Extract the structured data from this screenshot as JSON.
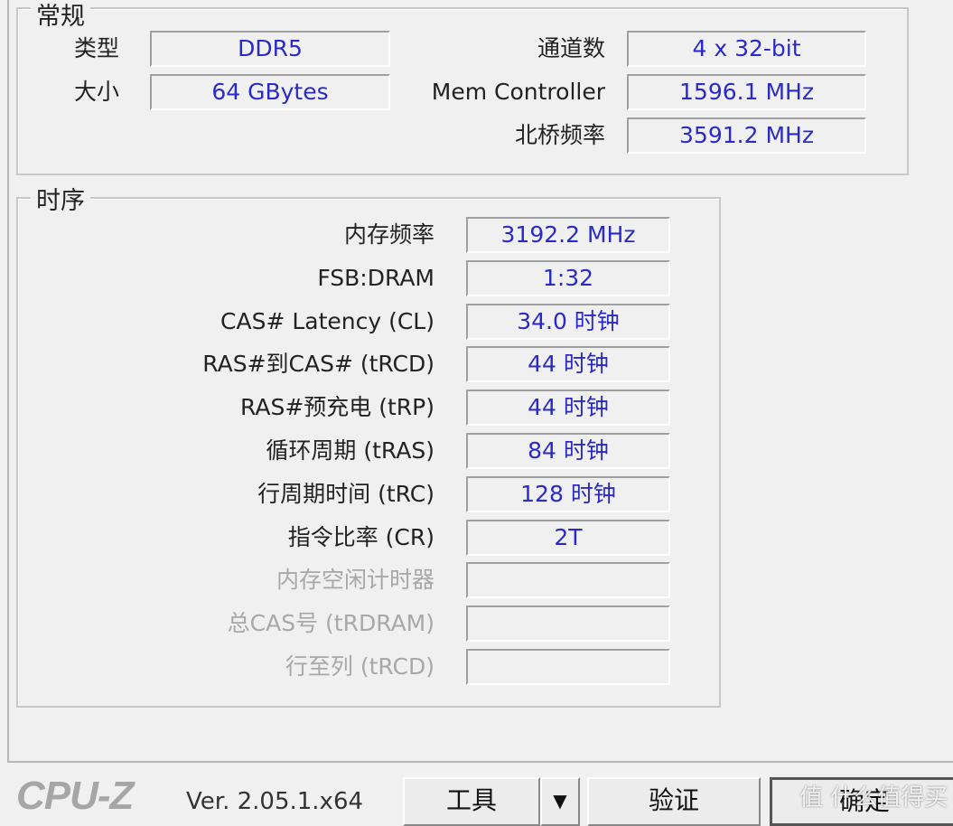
{
  "general": {
    "title": "常规",
    "type_label": "类型",
    "type_value": "DDR5",
    "size_label": "大小",
    "size_value": "64 GBytes",
    "channels_label": "通道数",
    "channels_value": "4 x 32-bit",
    "memctrl_label": "Mem Controller",
    "memctrl_value": "1596.1 MHz",
    "nb_label": "北桥频率",
    "nb_value": "3591.2 MHz"
  },
  "timings": {
    "title": "时序",
    "rows": [
      {
        "label": "内存频率",
        "value": "3192.2 MHz",
        "disabled": false
      },
      {
        "label": "FSB:DRAM",
        "value": "1:32",
        "disabled": false
      },
      {
        "label": "CAS# Latency (CL)",
        "value": "34.0 时钟",
        "disabled": false
      },
      {
        "label": "RAS#到CAS# (tRCD)",
        "value": "44 时钟",
        "disabled": false
      },
      {
        "label": "RAS#预充电 (tRP)",
        "value": "44 时钟",
        "disabled": false
      },
      {
        "label": "循环周期 (tRAS)",
        "value": "84 时钟",
        "disabled": false
      },
      {
        "label": "行周期时间 (tRC)",
        "value": "128 时钟",
        "disabled": false
      },
      {
        "label": "指令比率 (CR)",
        "value": "2T",
        "disabled": false
      },
      {
        "label": "内存空闲计时器",
        "value": "",
        "disabled": true
      },
      {
        "label": "总CAS号 (tRDRAM)",
        "value": "",
        "disabled": true
      },
      {
        "label": "行至列 (tRCD)",
        "value": "",
        "disabled": true
      }
    ]
  },
  "footer": {
    "logo": "CPU-Z",
    "version": "Ver. 2.05.1.x64",
    "tools_label": "工具",
    "validate_label": "验证",
    "ok_label": "确定",
    "watermark": "值 什么值得买"
  }
}
